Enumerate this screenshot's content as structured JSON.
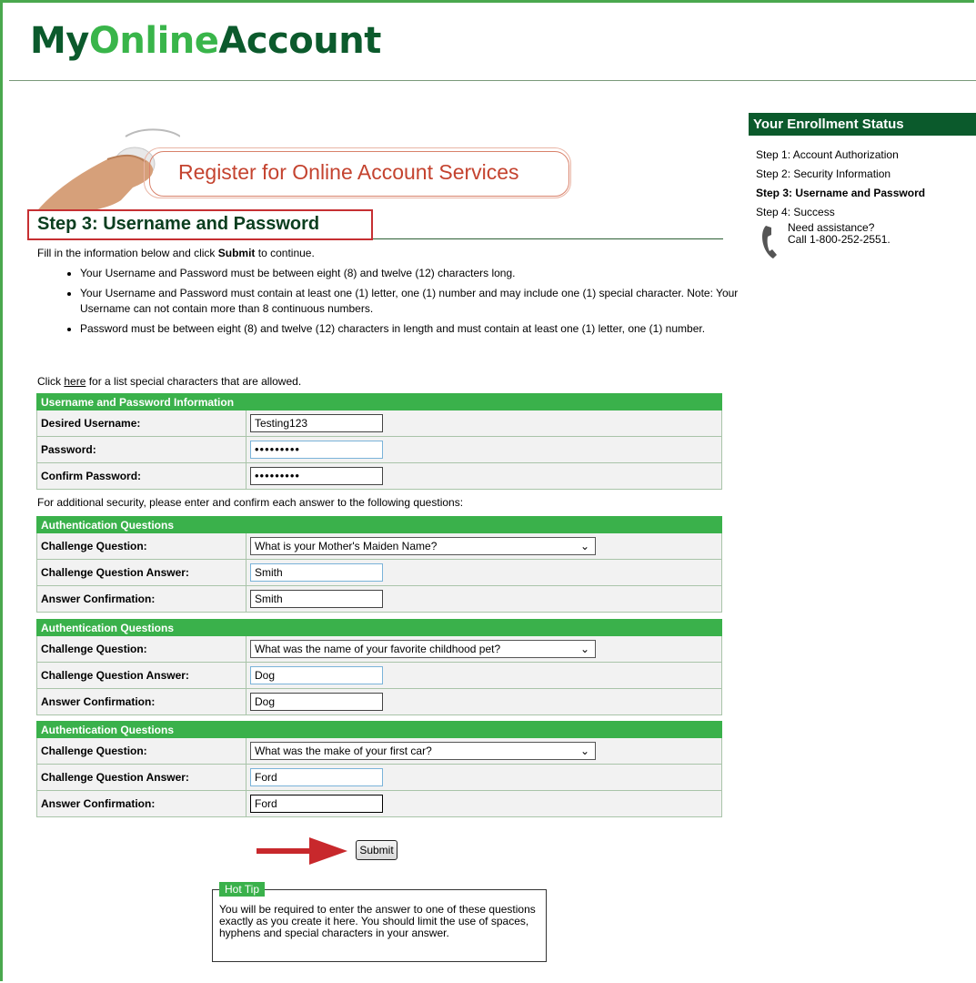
{
  "header": {
    "logo_my": "My",
    "logo_online": "Online",
    "logo_account": "Account"
  },
  "banner": {
    "title": "Register for Online Account Services"
  },
  "page": {
    "step_title": "Step 3: Username and Password",
    "intro_prefix": "Fill in the information below and click ",
    "intro_bold": "Submit",
    "intro_suffix": " to continue.",
    "rules": [
      "Your Username and Password must be between eight (8) and twelve (12) characters long.",
      "Your Username and Password must contain at least one (1) letter, one (1) number and may include one (1) special character.  Note: Your Username can not contain more than 8 continuous numbers.",
      "Password must be between eight (8) and twelve (12) characters in length and must contain at least one (1) letter, one (1) number."
    ],
    "click_prefix": "Click ",
    "click_link": "here",
    "click_suffix": " for a list special characters that are allowed.",
    "additional_security": "For additional security, please enter and confirm each answer to the following questions:"
  },
  "credentials": {
    "section_title": "Username and Password Information",
    "username_label": "Desired Username:",
    "username_value": "Testing123",
    "password_label": "Password:",
    "password_value": "•••••••••",
    "confirm_label": "Confirm Password:",
    "confirm_value": "•••••••••"
  },
  "questions": [
    {
      "section_title": "Authentication Questions",
      "question_label": "Challenge Question:",
      "question_value": "What is your Mother's Maiden Name?",
      "answer_label": "Challenge Question Answer:",
      "answer_value": "Smith",
      "confirm_label": "Answer Confirmation:",
      "confirm_value": "Smith"
    },
    {
      "section_title": "Authentication Questions",
      "question_label": "Challenge Question:",
      "question_value": "What was the name of your favorite childhood pet?",
      "answer_label": "Challenge Question Answer:",
      "answer_value": "Dog",
      "confirm_label": "Answer Confirmation:",
      "confirm_value": "Dog"
    },
    {
      "section_title": "Authentication Questions",
      "question_label": "Challenge Question:",
      "question_value": "What was the make of your first car?",
      "answer_label": "Challenge Question Answer:",
      "answer_value": "Ford",
      "confirm_label": "Answer Confirmation:",
      "confirm_value": "Ford"
    }
  ],
  "actions": {
    "submit_label": "Submit"
  },
  "hot_tip": {
    "legend": "Hot Tip",
    "text": "You will be required to enter the answer to one of these questions exactly as you create it here.  You should limit the use of spaces, hyphens and special characters in your answer."
  },
  "sidebar": {
    "title": "Your Enrollment Status",
    "steps": [
      "Step 1: Account Authorization",
      "Step 2: Security Information",
      "Step 3: Username and Password",
      "Step 4: Success"
    ],
    "assist_line1": "Need assistance?",
    "assist_line2": "Call 1-800-252-2551."
  },
  "colors": {
    "brand_dark_green": "#0b5a2c",
    "brand_light_green": "#39b54a",
    "section_header_green": "#3ab14b",
    "banner_red": "#c4432f",
    "highlight_red": "#c62f32"
  }
}
